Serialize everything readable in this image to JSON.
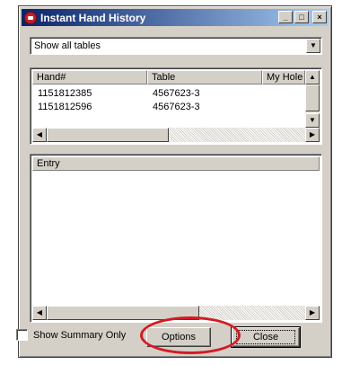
{
  "window": {
    "title": "Instant Hand History",
    "minimize_label": "_",
    "maximize_label": "□",
    "close_label": "×"
  },
  "filter": {
    "selected": "Show all tables"
  },
  "hands_table": {
    "columns": [
      "Hand#",
      "Table",
      "My Hole Card"
    ],
    "rows": [
      {
        "hand": "1151812385",
        "table": "4567623-3"
      },
      {
        "hand": "1151812596",
        "table": "4567623-3"
      }
    ]
  },
  "entry_panel": {
    "header": "Entry"
  },
  "footer": {
    "show_summary_label": "Show Summary Only",
    "show_summary_checked": false,
    "options_label": "Options",
    "close_label": "Close"
  },
  "annotation": {
    "highlight_color": "#d31b24"
  },
  "icons": {
    "app": "poker-chip-icon",
    "dropdown": "chevron-down-icon",
    "scroll_up": "arrow-up-icon",
    "scroll_down": "arrow-down-icon",
    "scroll_left": "arrow-left-icon",
    "scroll_right": "arrow-right-icon"
  }
}
